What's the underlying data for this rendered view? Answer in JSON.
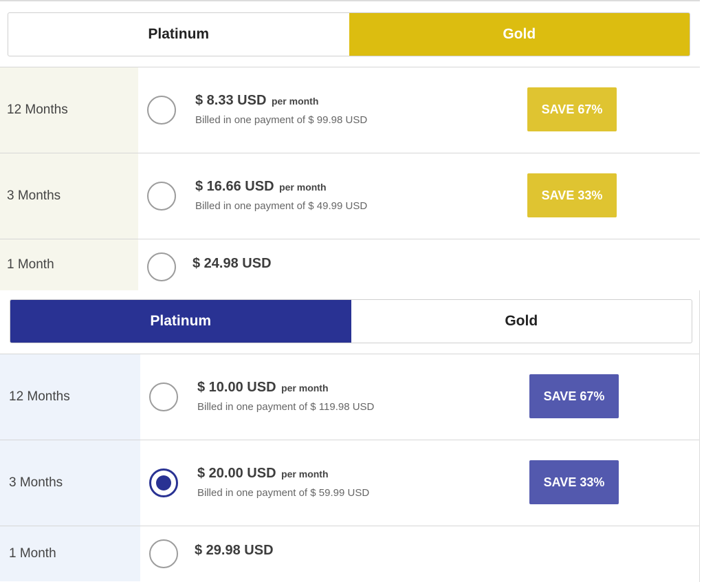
{
  "gold_panel": {
    "tabs": [
      {
        "label": "Platinum",
        "active": false
      },
      {
        "label": "Gold",
        "active": true
      }
    ],
    "plans": [
      {
        "term": "12 Months",
        "price": "$ 8.33 USD",
        "per": "per month",
        "billed": "Billed in one payment of $ 99.98 USD",
        "save": "SAVE 67%",
        "selected": false
      },
      {
        "term": "3 Months",
        "price": "$ 16.66 USD",
        "per": "per month",
        "billed": "Billed in one payment of $ 49.99 USD",
        "save": "SAVE 33%",
        "selected": false
      },
      {
        "term": "1 Month",
        "price": "$ 24.98 USD",
        "selected": false
      }
    ]
  },
  "platinum_panel": {
    "tabs": [
      {
        "label": "Platinum",
        "active": true
      },
      {
        "label": "Gold",
        "active": false
      }
    ],
    "plans": [
      {
        "term": "12 Months",
        "price": "$ 10.00 USD",
        "per": "per month",
        "billed": "Billed in one payment of $ 119.98 USD",
        "save": "SAVE 67%",
        "selected": false
      },
      {
        "term": "3 Months",
        "price": "$ 20.00 USD",
        "per": "per month",
        "billed": "Billed in one payment of $ 59.99 USD",
        "save": "SAVE 33%",
        "selected": true
      },
      {
        "term": "1 Month",
        "price": "$ 29.98 USD",
        "selected": false
      }
    ]
  },
  "colors": {
    "gold_accent": "#dcbd10",
    "gold_badge": "#dfc431",
    "platinum_accent": "#293293",
    "platinum_badge": "#5359ae"
  }
}
